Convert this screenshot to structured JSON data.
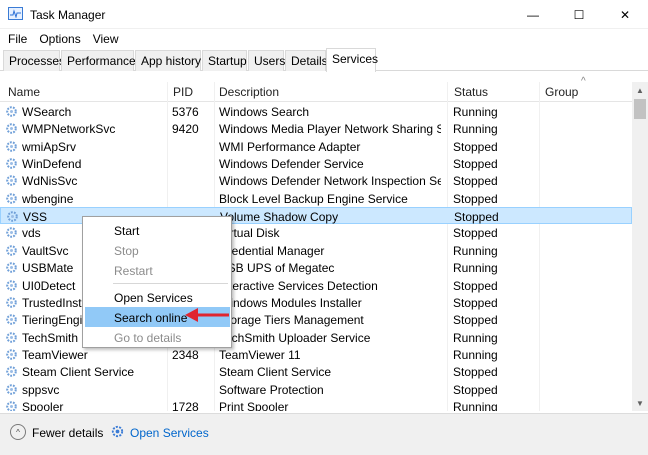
{
  "window": {
    "title": "Task Manager",
    "icon": "task-manager-icon"
  },
  "window_controls": {
    "minimize": "—",
    "maximize": "☐",
    "close": "✕"
  },
  "menu": [
    "File",
    "Options",
    "View"
  ],
  "tabs": [
    "Processes",
    "Performance",
    "App history",
    "Startup",
    "Users",
    "Details",
    "Services"
  ],
  "active_tab": "Services",
  "columns": {
    "name": "Name",
    "pid": "PID",
    "description": "Description",
    "status": "Status",
    "group": "Group"
  },
  "rows": [
    {
      "name": "WSearch",
      "pid": "5376",
      "description": "Windows Search",
      "status": "Running",
      "group": ""
    },
    {
      "name": "WMPNetworkSvc",
      "pid": "9420",
      "description": "Windows Media Player Network Sharing Ser...",
      "status": "Running",
      "group": ""
    },
    {
      "name": "wmiApSrv",
      "pid": "",
      "description": "WMI Performance Adapter",
      "status": "Stopped",
      "group": ""
    },
    {
      "name": "WinDefend",
      "pid": "",
      "description": "Windows Defender Service",
      "status": "Stopped",
      "group": ""
    },
    {
      "name": "WdNisSvc",
      "pid": "",
      "description": "Windows Defender Network Inspection Serv...",
      "status": "Stopped",
      "group": ""
    },
    {
      "name": "wbengine",
      "pid": "",
      "description": "Block Level Backup Engine Service",
      "status": "Stopped",
      "group": ""
    },
    {
      "name": "VSS",
      "pid": "",
      "description": "Volume Shadow Copy",
      "status": "Stopped",
      "group": "",
      "selected": true
    },
    {
      "name": "vds",
      "pid": "",
      "description": "Virtual Disk",
      "status": "Stopped",
      "group": ""
    },
    {
      "name": "VaultSvc",
      "pid": "",
      "description": "Credential Manager",
      "status": "Running",
      "group": ""
    },
    {
      "name": "USBMate",
      "pid": "",
      "description": "USB UPS of Megatec",
      "status": "Running",
      "group": ""
    },
    {
      "name": "UI0Detect",
      "pid": "",
      "description": "Interactive Services Detection",
      "status": "Stopped",
      "group": ""
    },
    {
      "name": "TrustedInstaller",
      "pid": "",
      "description": "Windows Modules Installer",
      "status": "Stopped",
      "group": ""
    },
    {
      "name": "TieringEngineService",
      "pid": "",
      "description": "Storage Tiers Management",
      "status": "Stopped",
      "group": ""
    },
    {
      "name": "TechSmith Uploader Service",
      "pid": "",
      "description": "TechSmith Uploader Service",
      "status": "Running",
      "group": ""
    },
    {
      "name": "TeamViewer",
      "pid": "2348",
      "description": "TeamViewer 11",
      "status": "Running",
      "group": ""
    },
    {
      "name": "Steam Client Service",
      "pid": "",
      "description": "Steam Client Service",
      "status": "Stopped",
      "group": ""
    },
    {
      "name": "sppsvc",
      "pid": "",
      "description": "Software Protection",
      "status": "Stopped",
      "group": ""
    },
    {
      "name": "Spooler",
      "pid": "1728",
      "description": "Print Spooler",
      "status": "Running",
      "group": ""
    }
  ],
  "context_menu": {
    "start": "Start",
    "stop": "Stop",
    "restart": "Restart",
    "open_services": "Open Services",
    "search_online": "Search online",
    "go_to_details": "Go to details"
  },
  "footer": {
    "fewer_details": "Fewer details",
    "open_services": "Open Services"
  },
  "colors": {
    "selection": "#cce8ff",
    "menu_hover": "#91c9f7",
    "link": "#0066cc",
    "arrow": "#e0252f"
  }
}
